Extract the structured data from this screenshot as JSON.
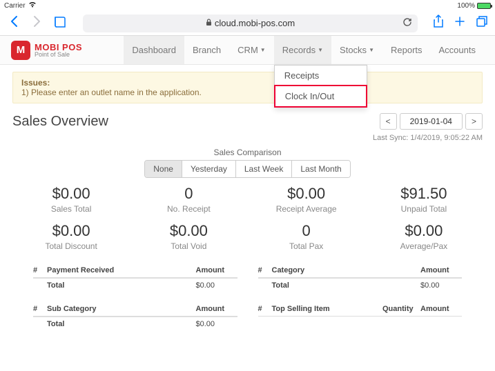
{
  "status": {
    "carrier": "Carrier",
    "battery_pct": "100%"
  },
  "browser": {
    "url": "cloud.mobi-pos.com"
  },
  "logo": {
    "letter": "M",
    "title": "MOBI POS",
    "sub": "Point of Sale"
  },
  "nav": {
    "dashboard": "Dashboard",
    "branch": "Branch",
    "crm": "CRM",
    "records": "Records",
    "stocks": "Stocks",
    "reports": "Reports",
    "accounts": "Accounts"
  },
  "dropdown": {
    "receipts": "Receipts",
    "clock": "Clock In/Out"
  },
  "alert": {
    "title": "Issues:",
    "line1": "1) Please enter an outlet name in the application."
  },
  "page": {
    "title": "Sales Overview",
    "date": "2019-01-04",
    "prev": "<",
    "next": ">"
  },
  "sync": {
    "label": "Last Sync: ",
    "value": "1/4/2019, 9:05:22 AM"
  },
  "comparison": {
    "title": "Sales Comparison",
    "none": "None",
    "yesterday": "Yesterday",
    "lastweek": "Last Week",
    "lastmonth": "Last Month"
  },
  "metrics": {
    "r1": {
      "v1": "$0.00",
      "v2": "0",
      "v3": "$0.00",
      "v4": "$91.50"
    },
    "l1": {
      "v1": "Sales Total",
      "v2": "No. Receipt",
      "v3": "Receipt Average",
      "v4": "Unpaid Total"
    },
    "r2": {
      "v1": "$0.00",
      "v2": "$0.00",
      "v3": "0",
      "v4": "$0.00"
    },
    "l2": {
      "v1": "Total Discount",
      "v2": "Total Void",
      "v3": "Total Pax",
      "v4": "Average/Pax"
    }
  },
  "tbl": {
    "hash": "#",
    "payment": "Payment Received",
    "category": "Category",
    "subcategory": "Sub Category",
    "topselling": "Top Selling Item",
    "amount": "Amount",
    "quantity": "Quantity",
    "total": "Total",
    "zero": "$0.00"
  }
}
